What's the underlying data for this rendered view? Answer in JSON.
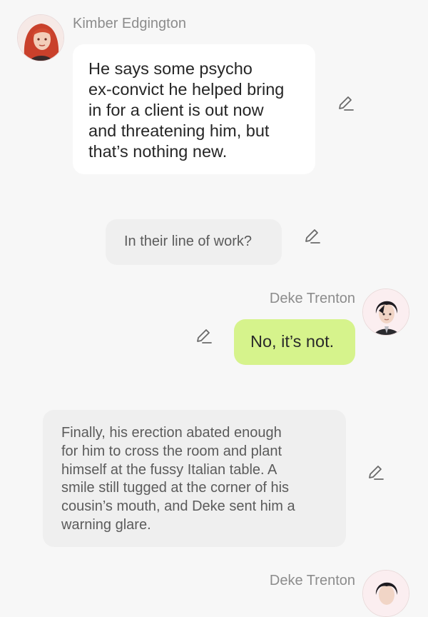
{
  "messages": [
    {
      "sender": "Kimber Edgington",
      "text": "He says some psycho\nex-convict he helped bring\nin for a client is out now\nand threatening him, but\nthat’s nothing new."
    },
    {
      "text": "In their line of work?"
    },
    {
      "sender": "Deke Trenton",
      "text": "No, it’s not."
    },
    {
      "text": "Finally, his erection abated enough\nfor him to cross the room and plant\nhimself at the fussy Italian table. A\nsmile still tugged at the corner of his\ncousin’s mouth, and Deke sent him a\nwarning glare."
    },
    {
      "sender": "Deke Trenton"
    }
  ],
  "colors": {
    "background": "#f7f7f7",
    "incoming_bubble": "#ffffff",
    "narration_bubble": "#efefef",
    "outgoing_bubble": "#d6f38c",
    "sender_name": "#8c8c8c"
  },
  "icons": [
    "avatar-kimber",
    "avatar-deke",
    "edit-pencil-icon"
  ]
}
